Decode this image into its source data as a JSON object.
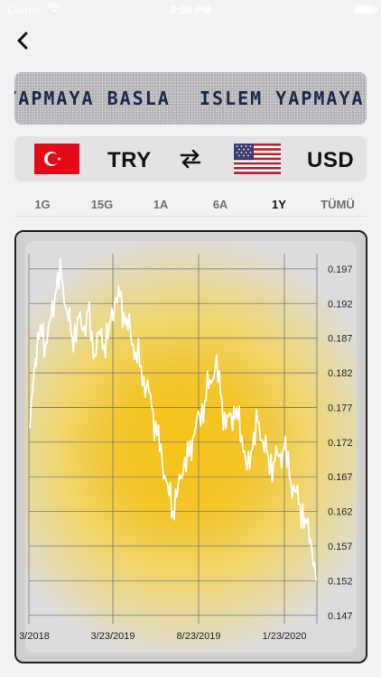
{
  "status_bar": {
    "carrier": "Carrier",
    "time": "8:00 PM"
  },
  "ticker": {
    "text": "ISLEM YAPMAYA BASLA"
  },
  "currency_pair": {
    "from_code": "TRY",
    "to_code": "USD"
  },
  "range_tabs": [
    {
      "label": "1G",
      "active": false
    },
    {
      "label": "15G",
      "active": false
    },
    {
      "label": "1A",
      "active": false
    },
    {
      "label": "6A",
      "active": false
    },
    {
      "label": "1Y",
      "active": true
    },
    {
      "label": "TÜMÜ",
      "active": false
    }
  ],
  "colors": {
    "accent_yellow": "#f5c518",
    "line": "#ffffff",
    "flag_red": "#e30a17"
  },
  "icons": {
    "back": "chevron-left-icon",
    "swap": "swap-arrows-icon"
  },
  "chart_data": {
    "type": "line",
    "x_tick_labels": [
      "3/2018",
      "3/23/2019",
      "8/23/2019",
      "1/23/2020"
    ],
    "y_ticks": [
      0.147,
      0.152,
      0.157,
      0.162,
      0.167,
      0.172,
      0.177,
      0.182,
      0.187,
      0.192,
      0.197
    ],
    "ylim": [
      0.1458,
      0.1992
    ],
    "grid": true,
    "series": [
      {
        "values": [
          0.174,
          0.184,
          0.189,
          0.186,
          0.19,
          0.194,
          0.196,
          0.191,
          0.187,
          0.19,
          0.188,
          0.191,
          0.184,
          0.188,
          0.186,
          0.189,
          0.192,
          0.193,
          0.189,
          0.188,
          0.185,
          0.183,
          0.18,
          0.177,
          0.173,
          0.169,
          0.166,
          0.162,
          0.166,
          0.168,
          0.17,
          0.173,
          0.176,
          0.178,
          0.181,
          0.183,
          0.179,
          0.174,
          0.176,
          0.177,
          0.173,
          0.168,
          0.171,
          0.175,
          0.172,
          0.17,
          0.169,
          0.17,
          0.171,
          0.167,
          0.165,
          0.163,
          0.161,
          0.158,
          0.152
        ]
      }
    ]
  }
}
